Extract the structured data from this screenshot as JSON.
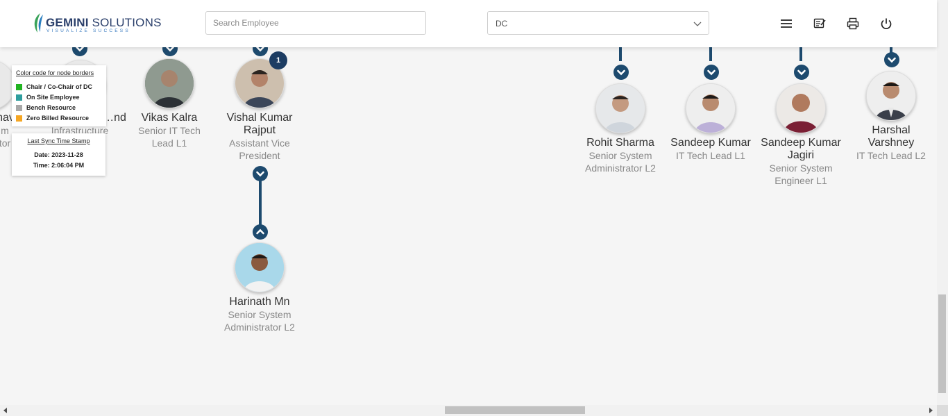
{
  "header": {
    "logo": {
      "brand_bold": "GEMINI",
      "brand_light": " SOLUTIONS",
      "tagline": "VISUALIZE SUCCESS",
      "icon": "gemini-leaf-logo"
    },
    "search": {
      "placeholder": "Search Employee",
      "value": ""
    },
    "department_select": {
      "value": "DC",
      "icon": "chevron-down-icon"
    },
    "actions": [
      {
        "name": "menu-icon"
      },
      {
        "name": "notes-icon"
      },
      {
        "name": "print-icon"
      },
      {
        "name": "power-icon"
      }
    ]
  },
  "legend": {
    "title": "Color code for node borders",
    "items": [
      {
        "label": "Chair / Co-Chair of DC",
        "color": "#22b422"
      },
      {
        "label": "On Site Employee",
        "color": "#2f9e9e"
      },
      {
        "label": "Bench Resource",
        "color": "#a8a8a8"
      },
      {
        "label": "Zero Billed Resource",
        "color": "#f5a623"
      }
    ]
  },
  "sync": {
    "title": "Last Sync Time Stamp",
    "date": "Date: 2023-11-28",
    "time": "Time: 2:06:04 PM"
  },
  "nodes": [
    {
      "name": "…hav",
      "designation": [
        "…m",
        "…tor"
      ]
    },
    {
      "name": "…nd",
      "designation": [
        "Infrastructure"
      ]
    },
    {
      "name": "Vikas Kalra",
      "designation": [
        "Senior IT Tech",
        "Lead L1"
      ]
    },
    {
      "name": [
        "Vishal Kumar",
        "Rajput"
      ],
      "designation": [
        "Assistant Vice",
        "President"
      ],
      "badge": "1"
    },
    {
      "name": "Harinath Mn",
      "designation": [
        "Senior System",
        "Administrator L2"
      ]
    },
    {
      "name": "Rohit Sharma",
      "designation": [
        "Senior System",
        "Administrator L2"
      ]
    },
    {
      "name": "Sandeep Kumar",
      "designation": [
        "IT Tech Lead L1"
      ]
    },
    {
      "name": [
        "Sandeep Kumar",
        "Jagiri"
      ],
      "designation": [
        "Senior System",
        "Engineer L1"
      ]
    },
    {
      "name": [
        "Harshal",
        "Varshney"
      ],
      "designation": [
        "IT Tech Lead L2"
      ]
    }
  ],
  "colors": {
    "accent": "#1d4a6e",
    "badge": "#1d3d63",
    "brand": "#2a3f6b"
  }
}
